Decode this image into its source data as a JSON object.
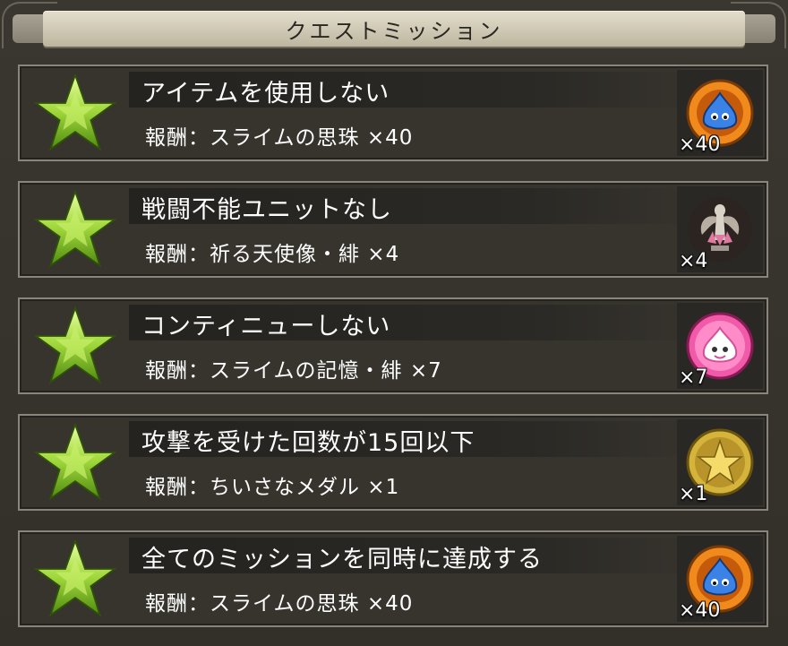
{
  "header": {
    "title": "クエストミッション"
  },
  "missions": [
    {
      "title": "アイテムを使用しない",
      "reward": "報酬：スライムの思珠 ×40",
      "item_icon": "orange-slime-orb-icon",
      "count": "×40",
      "icon_color": "#f08a1c"
    },
    {
      "title": "戦闘不能ユニットなし",
      "reward": "報酬：祈る天使像・緋 ×4",
      "item_icon": "angel-statue-icon",
      "count": "×4",
      "icon_color": "#c9a7a8"
    },
    {
      "title": "コンティニューしない",
      "reward": "報酬：スライムの記憶・緋 ×7",
      "item_icon": "pink-slime-memory-icon",
      "count": "×7",
      "icon_color": "#f05aa8"
    },
    {
      "title": "攻撃を受けた回数が15回以下",
      "reward": "報酬：ちいさなメダル ×1",
      "item_icon": "small-medal-icon",
      "count": "×1",
      "icon_color": "#d4b43a"
    },
    {
      "title": "全てのミッションを同時に達成する",
      "reward": "報酬：スライムの思珠 ×40",
      "item_icon": "orange-slime-orb-icon",
      "count": "×40",
      "icon_color": "#f08a1c"
    }
  ]
}
